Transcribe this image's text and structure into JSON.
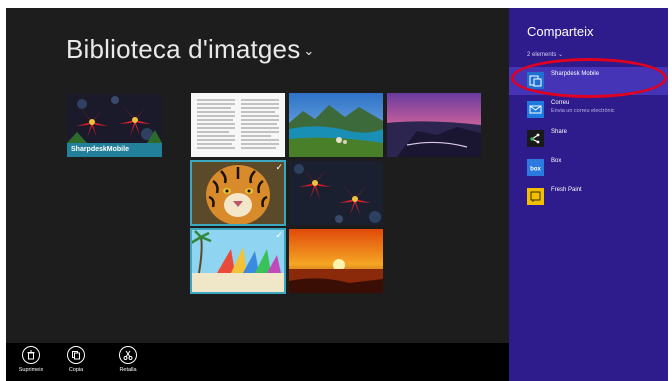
{
  "photos": {
    "title": "Biblioteca d'imatges",
    "title_chevron": "⌄",
    "folder": {
      "name": "SharpdeskMobile"
    },
    "tiles": [
      {
        "subject": "document page"
      },
      {
        "subject": "lake landscape"
      },
      {
        "subject": "coastal sunset"
      },
      {
        "subject": "tiger",
        "selected": true
      },
      {
        "subject": "red lilies"
      },
      {
        "subject": "beach sails",
        "selected": true
      },
      {
        "subject": "orange sunset"
      }
    ],
    "check_mark": "✓"
  },
  "appbar": {
    "buttons": [
      {
        "label": "Suprimeix",
        "icon": "trash-icon"
      },
      {
        "label": "Copia",
        "icon": "copy-icon"
      },
      {
        "label": "Retalla",
        "icon": "scissors-icon"
      }
    ]
  },
  "share": {
    "title": "Comparteix",
    "count": "2 elements  ⌄",
    "targets": [
      {
        "name": "Sharpdesk Mobile",
        "subtitle": "",
        "active": true,
        "icon": "sharpdesk-icon"
      },
      {
        "name": "Correu",
        "subtitle": "Envia un correu electrònic",
        "icon": "mail-icon"
      },
      {
        "name": "Share",
        "subtitle": "",
        "icon": "share-app-icon"
      },
      {
        "name": "Box",
        "subtitle": "",
        "icon": "box-icon"
      },
      {
        "name": "Fresh Paint",
        "subtitle": "",
        "icon": "fresh-paint-icon"
      }
    ],
    "colors": {
      "background": "#2f1c8c",
      "active": "#4534b6",
      "highlight": "#e0001f"
    }
  }
}
